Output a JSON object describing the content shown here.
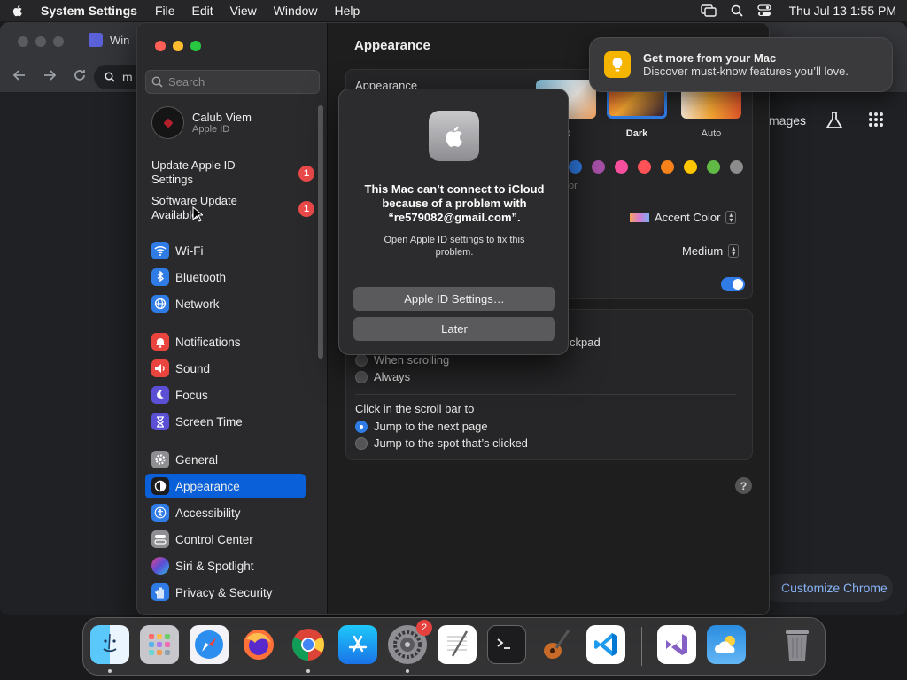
{
  "menubar": {
    "app_name": "System Settings",
    "menus": [
      "File",
      "Edit",
      "View",
      "Window",
      "Help"
    ],
    "clock": "Thu Jul 13  1:55 PM"
  },
  "chrome": {
    "tab_title": "Win",
    "omnibox_text": "m",
    "images_link": "mages",
    "customize_label": "Customize Chrome"
  },
  "sidebar": {
    "search_placeholder": "Search",
    "profile": {
      "name": "Calub Viem",
      "subtitle": "Apple ID"
    },
    "alerts": [
      {
        "label": "Update Apple ID Settings",
        "badge": "1"
      },
      {
        "label": "Software Update Available",
        "badge": "1"
      }
    ],
    "items": [
      {
        "label": "Wi-Fi",
        "icon": "wifi-icon",
        "color": "#2f7ce6"
      },
      {
        "label": "Bluetooth",
        "icon": "bluetooth-icon",
        "color": "#2f7ce6"
      },
      {
        "label": "Network",
        "icon": "globe-icon",
        "color": "#2f7ce6"
      },
      {
        "label": "Notifications",
        "icon": "bell-icon",
        "color": "#e9453e"
      },
      {
        "label": "Sound",
        "icon": "speaker-icon",
        "color": "#e9453e"
      },
      {
        "label": "Focus",
        "icon": "moon-icon",
        "color": "#5b4fd6"
      },
      {
        "label": "Screen Time",
        "icon": "hourglass-icon",
        "color": "#5b4fd6"
      },
      {
        "label": "General",
        "icon": "gear-icon",
        "color": "#8e8e93"
      },
      {
        "label": "Appearance",
        "icon": "appearance-icon",
        "color": "#1c1c1e"
      },
      {
        "label": "Accessibility",
        "icon": "accessibility-icon",
        "color": "#2f7ce6"
      },
      {
        "label": "Control Center",
        "icon": "control-center-icon",
        "color": "#8e8e93"
      },
      {
        "label": "Siri & Spotlight",
        "icon": "siri-icon",
        "color": "#b04ad6"
      },
      {
        "label": "Privacy & Security",
        "icon": "hand-icon",
        "color": "#2f7ce6"
      }
    ],
    "active_item": "Appearance"
  },
  "main": {
    "title": "Appearance",
    "appearance_label": "Appearance",
    "modes": [
      {
        "label": "nt"
      },
      {
        "label": "Dark",
        "selected": true
      },
      {
        "label": "Auto"
      }
    ],
    "accent_colors": [
      "#2f7ce6",
      "#a550a7",
      "#f74f9e",
      "#ff5257",
      "#f7821b",
      "#ffc600",
      "#62ba46",
      "#8c8c8c"
    ],
    "accent_caption": "or",
    "highlight_value": "Accent Color",
    "sidebar_icon_size": "Medium",
    "scroll_label_fragment": "ckpad",
    "show_scroll_options": [
      "When scrolling",
      "Always"
    ],
    "click_scroll_label": "Click in the scroll bar to",
    "click_scroll_options": [
      {
        "label": "Jump to the next page",
        "selected": true
      },
      {
        "label": "Jump to the spot that’s clicked",
        "selected": false
      }
    ],
    "help": "?"
  },
  "dialog": {
    "title": "This Mac can’t connect to iCloud because of a problem with “re579082@gmail.com”.",
    "message": "Open Apple ID settings to fix this problem.",
    "primary_button": "Apple ID Settings…",
    "secondary_button": "Later"
  },
  "notification": {
    "title": "Get more from your Mac",
    "body": "Discover must-know features you’ll love."
  },
  "dock": {
    "apps": [
      {
        "name": "Finder",
        "icon": "finder-icon",
        "running": true
      },
      {
        "name": "Launchpad",
        "icon": "launchpad-icon",
        "running": false
      },
      {
        "name": "Safari",
        "icon": "safari-icon",
        "running": false
      },
      {
        "name": "Firefox",
        "icon": "firefox-icon",
        "running": false
      },
      {
        "name": "Chrome",
        "icon": "chrome-icon",
        "running": true
      },
      {
        "name": "App Store",
        "icon": "app-store-icon",
        "running": false
      },
      {
        "name": "System Settings",
        "icon": "system-settings-icon",
        "running": true,
        "badge": "2"
      },
      {
        "name": "TextEdit",
        "icon": "textedit-icon",
        "running": false
      },
      {
        "name": "Terminal",
        "icon": "terminal-icon",
        "running": false
      },
      {
        "name": "GarageBand",
        "icon": "garageband-icon",
        "running": false
      },
      {
        "name": "VS Code",
        "icon": "vscode-icon",
        "running": false
      },
      {
        "name": "Visual Studio",
        "icon": "visual-studio-icon",
        "running": false
      },
      {
        "name": "Weather",
        "icon": "weather-icon",
        "running": false
      },
      {
        "name": "Trash",
        "icon": "trash-icon",
        "running": false
      }
    ]
  }
}
